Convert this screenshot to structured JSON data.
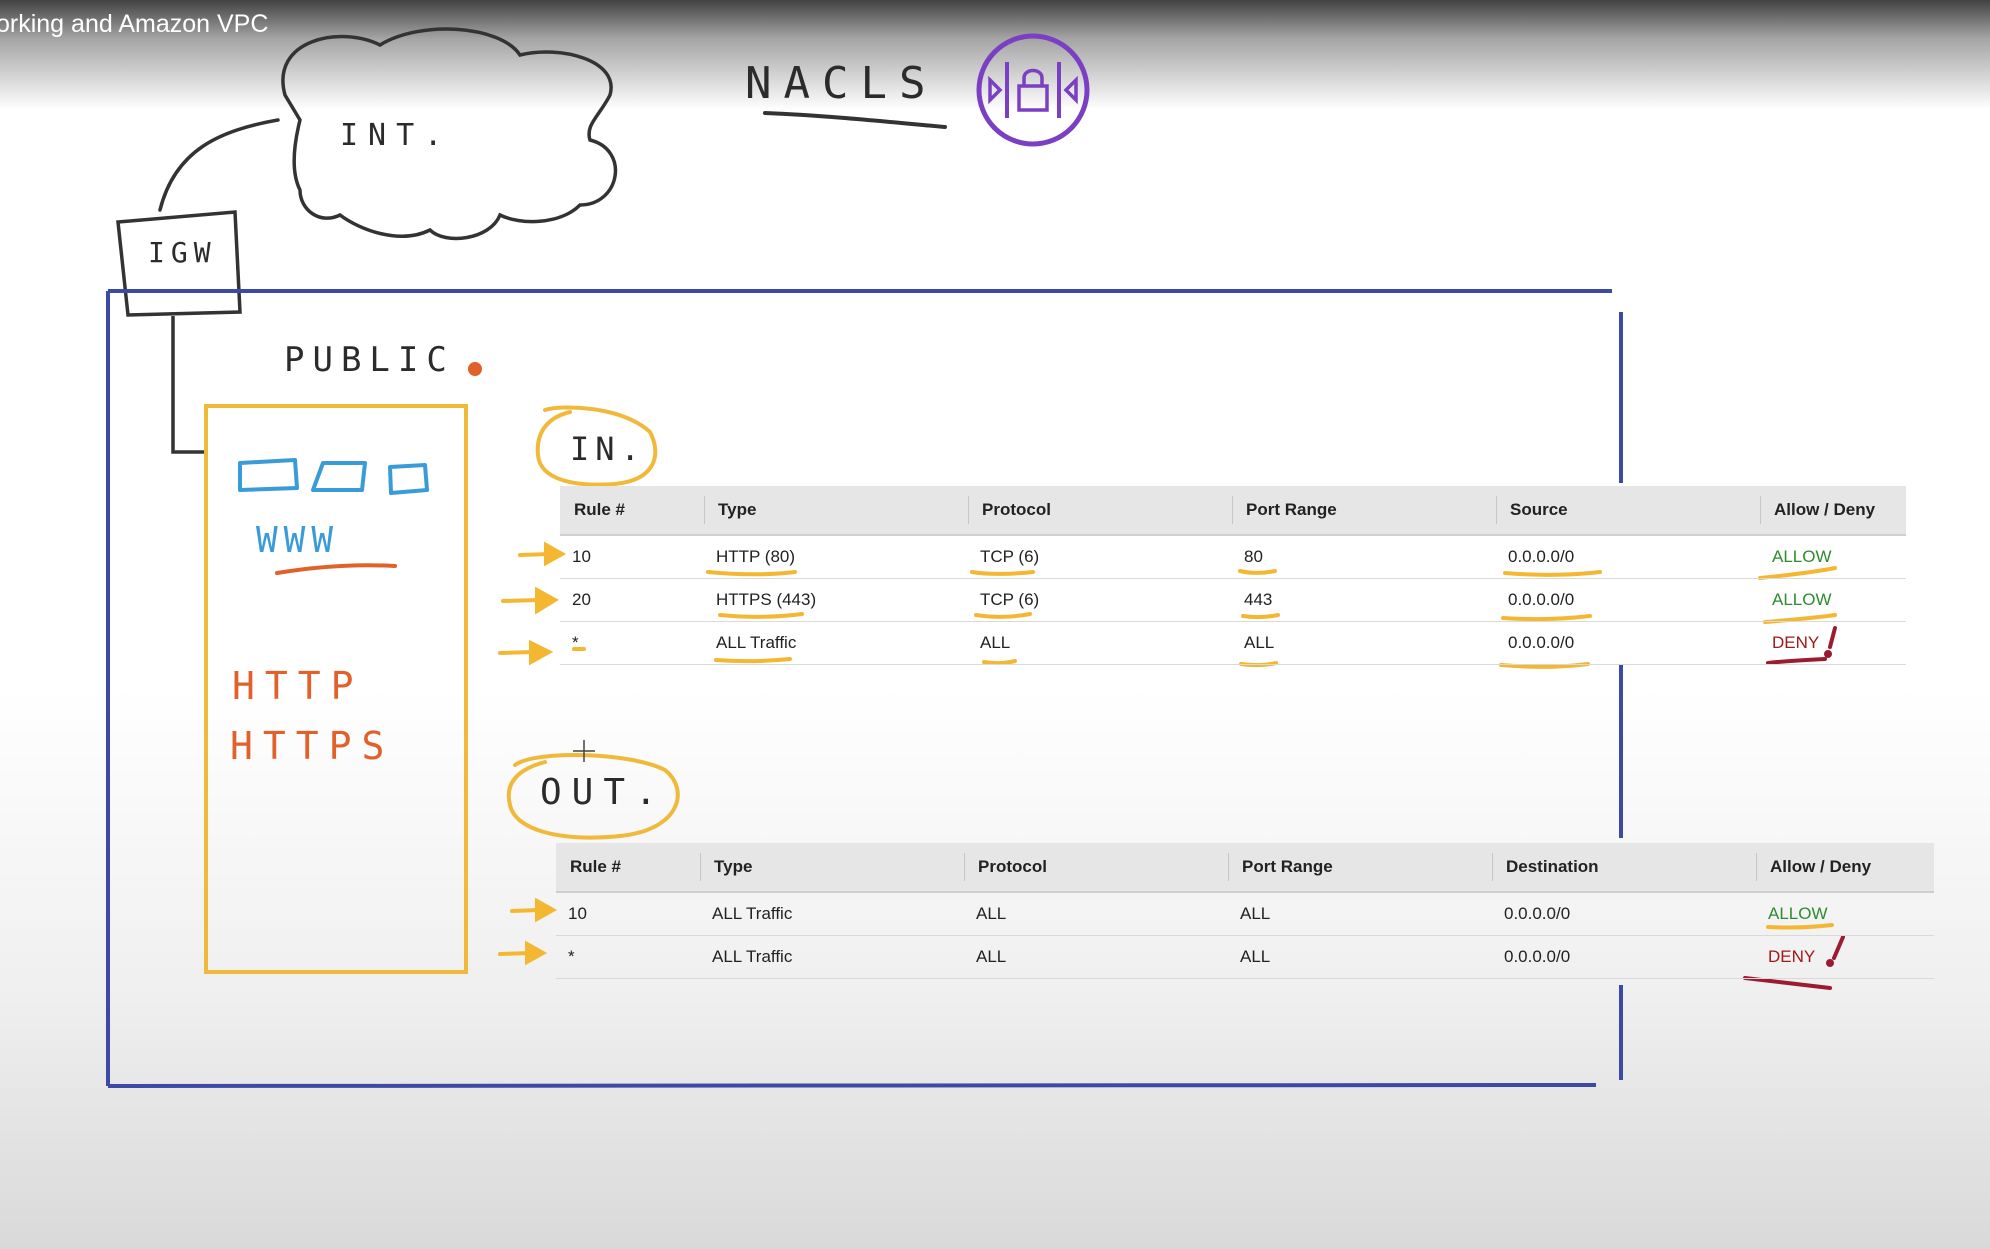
{
  "video_title": "orking and Amazon VPC",
  "labels": {
    "nacls": "NACLS",
    "internet": "INT.",
    "igw": "IGW",
    "public": "PUBLIC",
    "www": "WWW",
    "http": "HTTP",
    "https": "HTTPS",
    "inbound": "IN.",
    "outbound": "OUT."
  },
  "inbound_table": {
    "headers": [
      "Rule #",
      "Type",
      "Protocol",
      "Port Range",
      "Source",
      "Allow / Deny"
    ],
    "rows": [
      {
        "rule": "10",
        "type": "HTTP (80)",
        "protocol": "TCP (6)",
        "port": "80",
        "source": "0.0.0.0/0",
        "action": "ALLOW"
      },
      {
        "rule": "20",
        "type": "HTTPS (443)",
        "protocol": "TCP (6)",
        "port": "443",
        "source": "0.0.0.0/0",
        "action": "ALLOW"
      },
      {
        "rule": "*",
        "type": "ALL Traffic",
        "protocol": "ALL",
        "port": "ALL",
        "source": "0.0.0.0/0",
        "action": "DENY"
      }
    ]
  },
  "outbound_table": {
    "headers": [
      "Rule #",
      "Type",
      "Protocol",
      "Port Range",
      "Destination",
      "Allow / Deny"
    ],
    "rows": [
      {
        "rule": "10",
        "type": "ALL Traffic",
        "protocol": "ALL",
        "port": "ALL",
        "destination": "0.0.0.0/0",
        "action": "ALLOW"
      },
      {
        "rule": "*",
        "type": "ALL Traffic",
        "protocol": "ALL",
        "port": "ALL",
        "destination": "0.0.0.0/0",
        "action": "DENY"
      }
    ]
  },
  "colors": {
    "vpc_border": "#3c4aa6",
    "subnet_border": "#f0b93a",
    "highlight": "#f4b731",
    "www_blue": "#3a9bd9",
    "orange_text": "#e0622a",
    "nacl_icon": "#7b3fc4",
    "allow": "#2e8b2e",
    "deny": "#a01818",
    "deny_mark": "#9b1b30"
  },
  "icons": [
    "nacl-lock-icon",
    "arrow-icon",
    "star-icon",
    "cursor-icon"
  ]
}
